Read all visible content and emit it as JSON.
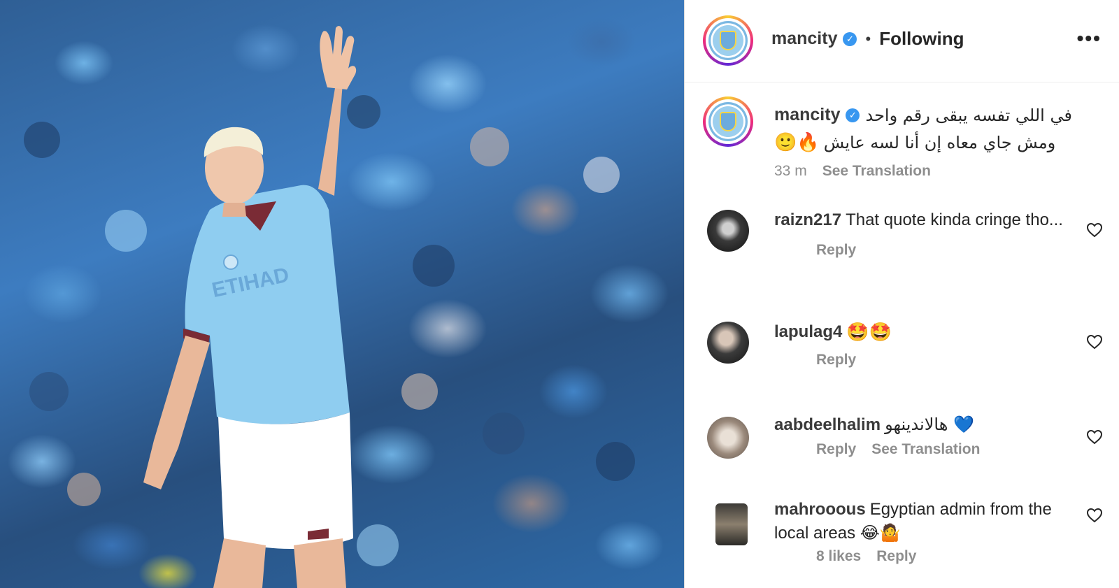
{
  "post": {
    "username": "mancity",
    "separator": "•",
    "follow_status": "Following",
    "more_icon": "more-horizontal-icon",
    "caption": {
      "username": "mancity",
      "line1": "في اللي تفسه يبقى رقم واحد",
      "line2": "ومش جاي معاه إن أنا لسه عايش",
      "emojis": "🙂🔥",
      "time": "33 m",
      "see_translation": "See Translation"
    }
  },
  "comments": [
    {
      "username": "raizn217",
      "text": "That quote kinda cringe tho...",
      "reply": "Reply",
      "extra": ""
    },
    {
      "username": "lapulag4",
      "text": "🤩🤩",
      "reply": "Reply",
      "extra": ""
    },
    {
      "username": "aabdeelhalim",
      "text": "هالاندينهو 💙",
      "reply": "Reply",
      "extra": "See Translation"
    },
    {
      "username": "mahrooous",
      "text": "Egyptian admin from the local areas 😂🤷",
      "likes": "8 likes",
      "reply": "Reply"
    }
  ],
  "colors": {
    "story_ring": [
      "#f9ce34",
      "#ee2a7b",
      "#6228d7"
    ],
    "verified": "#3897f0",
    "secondary_text": "#8e8e8e",
    "sky_blue_kit": "#8fcdf0"
  }
}
